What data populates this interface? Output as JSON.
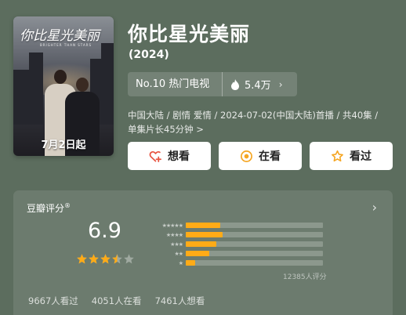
{
  "poster": {
    "title": "你比星光美丽",
    "subtitle": "BRIGHTER THAN STARS",
    "date_caption": "7月2日起"
  },
  "show": {
    "title": "你比星光美丽",
    "year": "(2024)",
    "rank": "No.10 热门电视",
    "heat": "5.4万",
    "meta_line1": "中国大陆 / 剧情 爱情 / 2024-07-02(中国大陆)首播 / 共40集 /",
    "meta_line2": "单集片长45分钟 >"
  },
  "actions": {
    "want": "想看",
    "watching": "在看",
    "watched": "看过"
  },
  "rating": {
    "label": "豆瓣评分",
    "mark": "®",
    "score": "6.9",
    "score_stars": 3.5,
    "distribution": [
      {
        "stars": "★★★★★",
        "fraction": 0.25
      },
      {
        "stars": "★★★★",
        "fraction": 0.27
      },
      {
        "stars": "★★★",
        "fraction": 0.22
      },
      {
        "stars": "★★",
        "fraction": 0.17
      },
      {
        "stars": "★",
        "fraction": 0.07
      }
    ],
    "count": "12385人评分",
    "stats": [
      "9667人看过",
      "4051人在看",
      "7461人想看"
    ]
  },
  "colors": {
    "background": "#5c6d5e",
    "accent": "#ffab17",
    "button_bg": "#ffffff",
    "want_icon": "#e8523f",
    "watching_icon": "#f5a623",
    "watched_icon": "#f5a623"
  },
  "icons": {
    "heat": "flame-icon",
    "want": "heart-plus-icon",
    "watching": "circle-dot-icon",
    "watched": "star-outline-icon",
    "more": "chevron-right-icon"
  }
}
